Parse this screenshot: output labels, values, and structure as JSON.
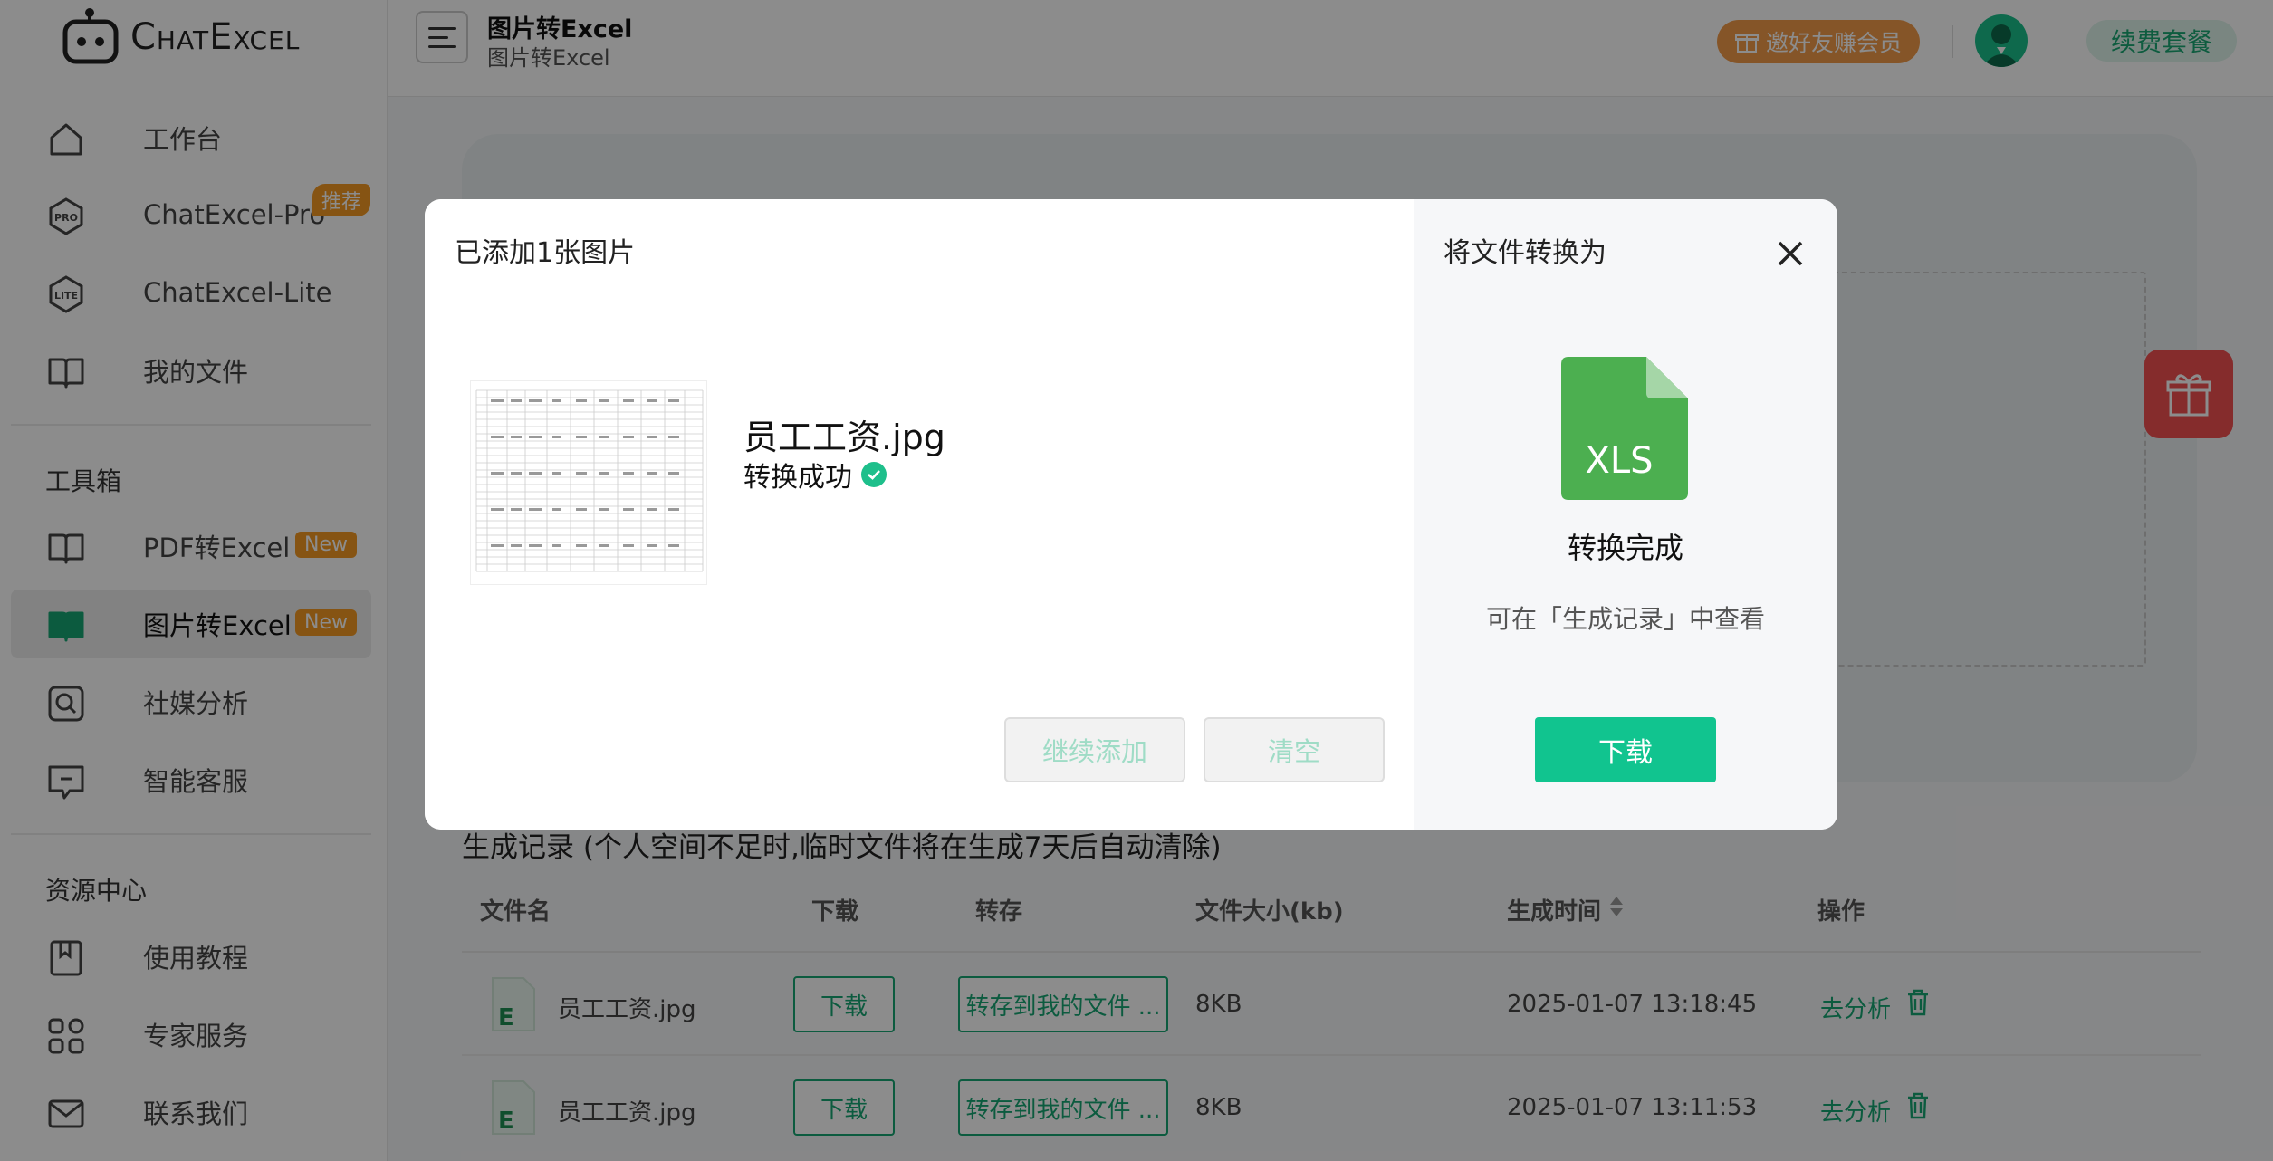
{
  "brand": {
    "name": "ChatExcel"
  },
  "sidebar": {
    "items": [
      {
        "label": "工作台",
        "icon": "home-icon"
      },
      {
        "label": "ChatExcel-Pro",
        "icon": "pro-icon",
        "badge": "推荐"
      },
      {
        "label": "ChatExcel-Lite",
        "icon": "lite-icon"
      },
      {
        "label": "我的文件",
        "icon": "book-icon"
      }
    ],
    "toolbox_title": "工具箱",
    "tools": [
      {
        "label": "PDF转Excel",
        "icon": "book-icon",
        "badge": "New"
      },
      {
        "label": "图片转Excel",
        "icon": "book-open-icon",
        "badge": "New",
        "active": true
      },
      {
        "label": "社媒分析",
        "icon": "search-icon"
      },
      {
        "label": "智能客服",
        "icon": "chat-icon"
      }
    ],
    "resources_title": "资源中心",
    "resources": [
      {
        "label": "使用教程",
        "icon": "bookmark-icon"
      },
      {
        "label": "专家服务",
        "icon": "grid-icon"
      },
      {
        "label": "联系我们",
        "icon": "mail-icon"
      }
    ]
  },
  "header": {
    "title": "图片转Excel",
    "subtitle": "图片转Excel",
    "invite_label": "邀好友赚会员",
    "renew_label": "续费套餐"
  },
  "records": {
    "title": "生成记录 (个人空间不足时,临时文件将在生成7天后自动清除)",
    "columns": [
      "文件名",
      "下载",
      "转存",
      "文件大小(kb)",
      "生成时间",
      "操作"
    ],
    "rows": [
      {
        "name": "员工工资.jpg",
        "download": "下载",
        "save": "转存到我的文件 ...",
        "size": "8KB",
        "time": "2025-01-07 13:18:45",
        "action": "去分析"
      },
      {
        "name": "员工工资.jpg",
        "download": "下载",
        "save": "转存到我的文件 ...",
        "size": "8KB",
        "time": "2025-01-07 13:11:53",
        "action": "去分析"
      }
    ]
  },
  "modal": {
    "title": "已添加1张图片",
    "file_name": "员工工资.jpg",
    "file_status": "转换成功",
    "continue_label": "继续添加",
    "clear_label": "清空",
    "right_title": "将文件转换为",
    "format_label": "XLS",
    "done_text": "转换完成",
    "hint_text": "可在「生成记录」中查看",
    "download_label": "下载"
  },
  "colors": {
    "accent": "#11c48f",
    "badge": "#f59a23",
    "overlay": "rgba(0,0,0,0.45)",
    "xls": "#4caf50"
  }
}
